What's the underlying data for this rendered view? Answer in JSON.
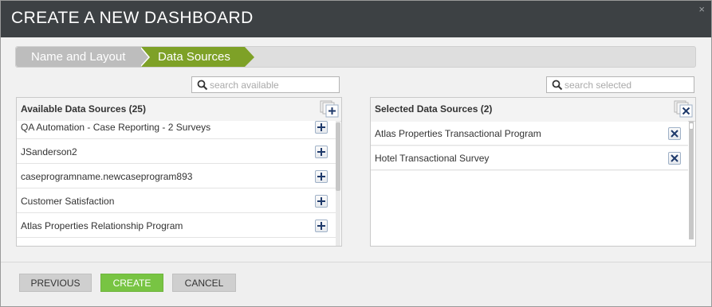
{
  "dialog": {
    "title": "CREATE A NEW DASHBOARD",
    "close_icon": "close-icon",
    "close_glyph": "×"
  },
  "wizard": {
    "steps": [
      {
        "label": "Name and Layout",
        "state": "completed"
      },
      {
        "label": "Data Sources",
        "state": "active"
      }
    ]
  },
  "available": {
    "search_placeholder": "search available",
    "header": "Available Data Sources (25)",
    "items": [
      "QA Automation - Case Reporting - 2 Surveys",
      "JSanderson2",
      "caseprogramname.newcaseprogram893",
      "Customer Satisfaction",
      "Atlas Properties Relationship Program"
    ],
    "add_all_icon": "add-all-icon",
    "item_icon": "plus-icon"
  },
  "selected": {
    "search_placeholder": "search selected",
    "header": "Selected Data Sources (2)",
    "items": [
      "Atlas Properties Transactional Program",
      "Hotel Transactional Survey"
    ],
    "remove_all_icon": "remove-all-icon",
    "item_icon": "remove-icon"
  },
  "footer": {
    "previous_label": "PREVIOUS",
    "create_label": "CREATE",
    "cancel_label": "CANCEL"
  },
  "colors": {
    "titlebar": "#3d4144",
    "active_step": "#7ea127",
    "completed_step": "#bdbdbd",
    "create_button": "#78c443",
    "icon_blue": "#1f3a6b"
  }
}
